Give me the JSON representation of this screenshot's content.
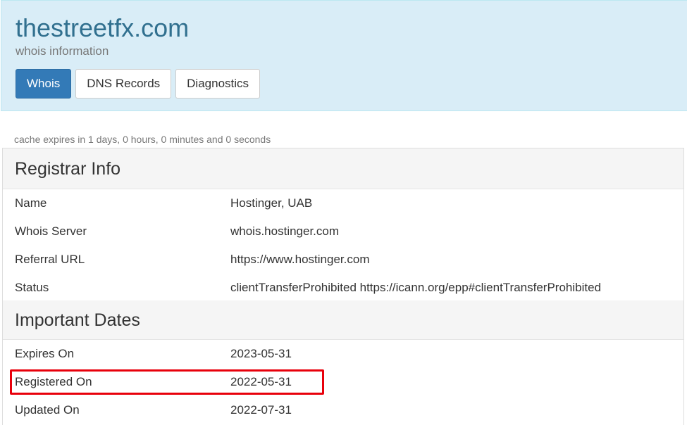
{
  "header": {
    "title": "thestreetfx.com",
    "subtitle": "whois information",
    "tabs": [
      {
        "label": "Whois",
        "active": true
      },
      {
        "label": "DNS Records",
        "active": false
      },
      {
        "label": "Diagnostics",
        "active": false
      }
    ]
  },
  "cache_note": "cache expires in 1 days, 0 hours, 0 minutes and 0 seconds",
  "registrar": {
    "heading": "Registrar Info",
    "rows": [
      {
        "label": "Name",
        "value": "Hostinger, UAB"
      },
      {
        "label": "Whois Server",
        "value": "whois.hostinger.com"
      },
      {
        "label": "Referral URL",
        "value": "https://www.hostinger.com"
      },
      {
        "label": "Status",
        "value": "clientTransferProhibited https://icann.org/epp#clientTransferProhibited"
      }
    ]
  },
  "dates": {
    "heading": "Important Dates",
    "rows": [
      {
        "label": "Expires On",
        "value": "2023-05-31"
      },
      {
        "label": "Registered On",
        "value": "2022-05-31"
      },
      {
        "label": "Updated On",
        "value": "2022-07-31"
      }
    ]
  },
  "colors": {
    "header_bg": "#d9edf7",
    "title": "#31708f",
    "active_tab": "#337ab7",
    "highlight": "#e8000b"
  }
}
